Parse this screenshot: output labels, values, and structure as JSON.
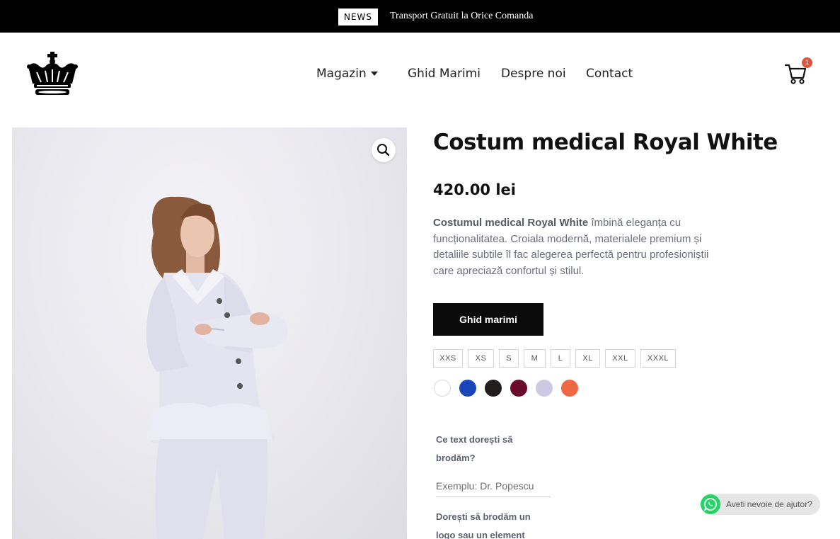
{
  "topbar": {
    "badge": "NEWS",
    "message": "Transport Gratuit la Orice Comanda"
  },
  "header": {
    "logo_icon": "crown-icon",
    "nav": [
      {
        "label": "Magazin",
        "has_dropdown": true
      },
      {
        "label": "Ghid Marimi"
      },
      {
        "label": "Despre noi"
      },
      {
        "label": "Contact"
      }
    ],
    "cart_icon": "cart-icon",
    "cart_count": "1"
  },
  "product": {
    "title": "Costum medical Royal White",
    "price": "420.00 lei",
    "description_bold": "Costumul medical Royal White",
    "description_rest": " îmbină eleganța cu funcționalitatea. Croiala modernă, materialele premium și detaliile subtile îl fac alegerea perfectă pentru profesioniștii care apreciază confortul și stilul.",
    "guide_button": "Ghid marimi",
    "sizes": [
      "XXS",
      "XS",
      "S",
      "M",
      "L",
      "XL",
      "XXL",
      "XXXL"
    ],
    "colors": [
      "#ffffff",
      "#1846b8",
      "#231c1c",
      "#6a0b2c",
      "#cdc8e4",
      "#ef6844"
    ],
    "zoom_icon": "magnifier-icon"
  },
  "embroidery": {
    "text_label": "Ce text dorești să brodăm?",
    "text_placeholder": "Exemplu: Dr. Popescu",
    "logo_label": "Dorești să brodăm un logo sau un element"
  },
  "whatsapp": {
    "icon": "whatsapp-icon",
    "text": "Aveti nevoie de ajutor?"
  }
}
